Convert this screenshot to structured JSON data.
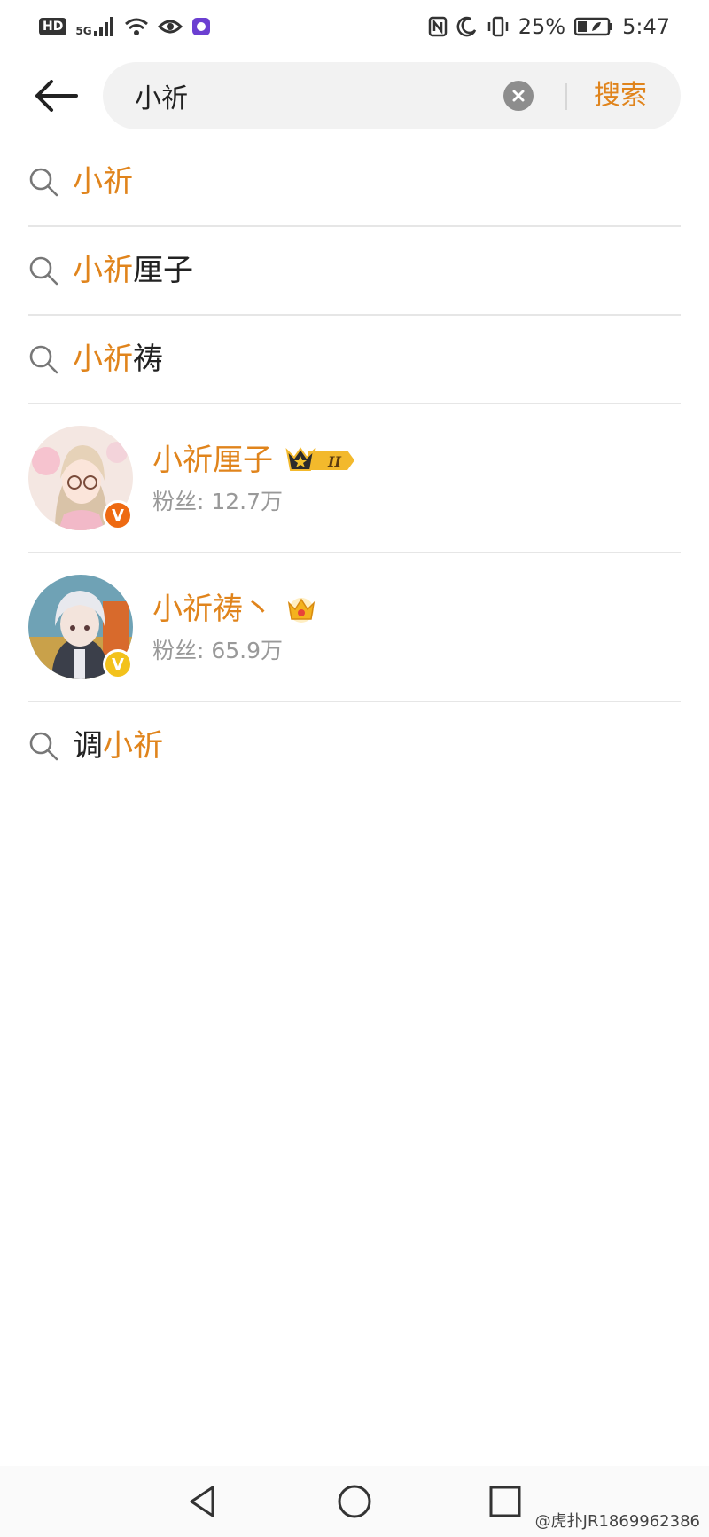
{
  "status_bar": {
    "left": {
      "hd": "HD",
      "network": "5G"
    },
    "right": {
      "battery_percent": "25%",
      "time": "5:47"
    }
  },
  "search": {
    "query": "小祈",
    "placeholder": "",
    "button_label": "搜索"
  },
  "suggestions_top": [
    {
      "highlight": "小祈",
      "rest": ""
    },
    {
      "highlight": "小祈",
      "rest": "厘子"
    },
    {
      "highlight": "小祈",
      "rest": "祷"
    }
  ],
  "users": [
    {
      "name": "小祈厘子",
      "fans": "粉丝: 12.7万",
      "badge": "crown-level-II-icon",
      "verify_color": "#ee6a12"
    },
    {
      "name": "小祈祷丶",
      "fans": "粉丝: 65.9万",
      "badge": "gold-crown-icon",
      "verify_color": "#f3c21c"
    }
  ],
  "suggestions_bottom": [
    {
      "prefix": "调",
      "highlight": "小祈"
    }
  ],
  "watermark": "@虎扑JR1869962386",
  "colors": {
    "accent": "#e0841c",
    "divider": "#e6e6e6",
    "search_bg": "#f2f2f2"
  }
}
